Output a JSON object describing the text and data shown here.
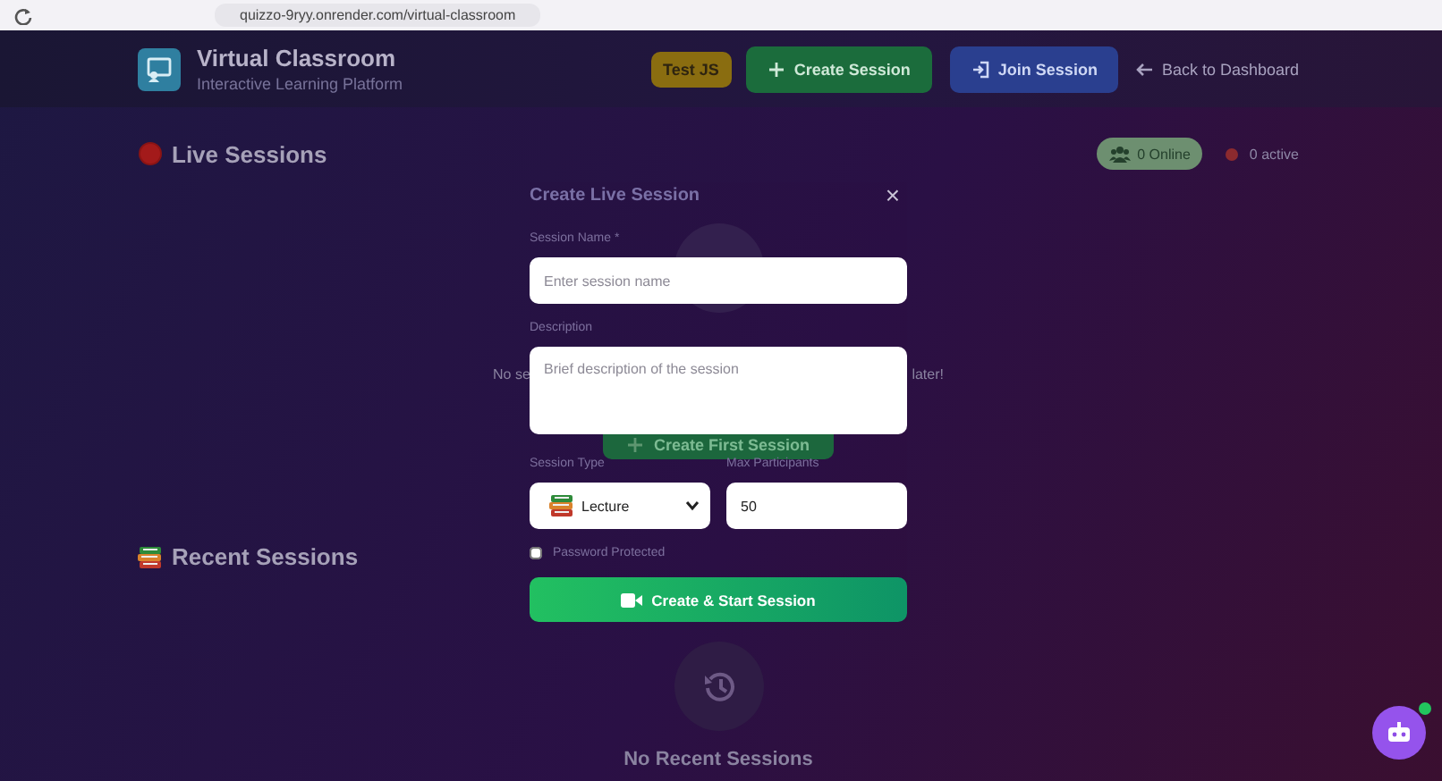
{
  "browser": {
    "url": "quizzo-9ryy.onrender.com/virtual-classroom"
  },
  "header": {
    "title": "Virtual Classroom",
    "subtitle": "Interactive Learning Platform",
    "buttons": [
      {
        "kind": "test",
        "label": "Test JS"
      },
      {
        "kind": "create",
        "label": "Create Session"
      },
      {
        "kind": "join",
        "label": "Join Session"
      }
    ],
    "back_link": "Back to Dashboard"
  },
  "live_sessions": {
    "title": "Live Sessions",
    "online_badge": "0 Online",
    "active_count": "0 active",
    "empty_text_parts": [
      "No se",
      "later!"
    ],
    "create_button": "Create First Session"
  },
  "recent_sessions": {
    "title": "Recent Sessions",
    "empty_title": "No Recent Sessions"
  },
  "modal": {
    "title": "Create Live Session",
    "close": "×",
    "session_name": {
      "label": "Session Name *",
      "placeholder": "Enter session name"
    },
    "description": {
      "label": "Description",
      "placeholder": "Brief description of the session"
    },
    "session_type": {
      "label": "Session Type",
      "value": "Lecture"
    },
    "max_participants": {
      "label": "Max Participants",
      "value": "50"
    },
    "password_protected": {
      "label": "Password Protected",
      "checked": false
    },
    "submit": "Create & Start Session"
  }
}
